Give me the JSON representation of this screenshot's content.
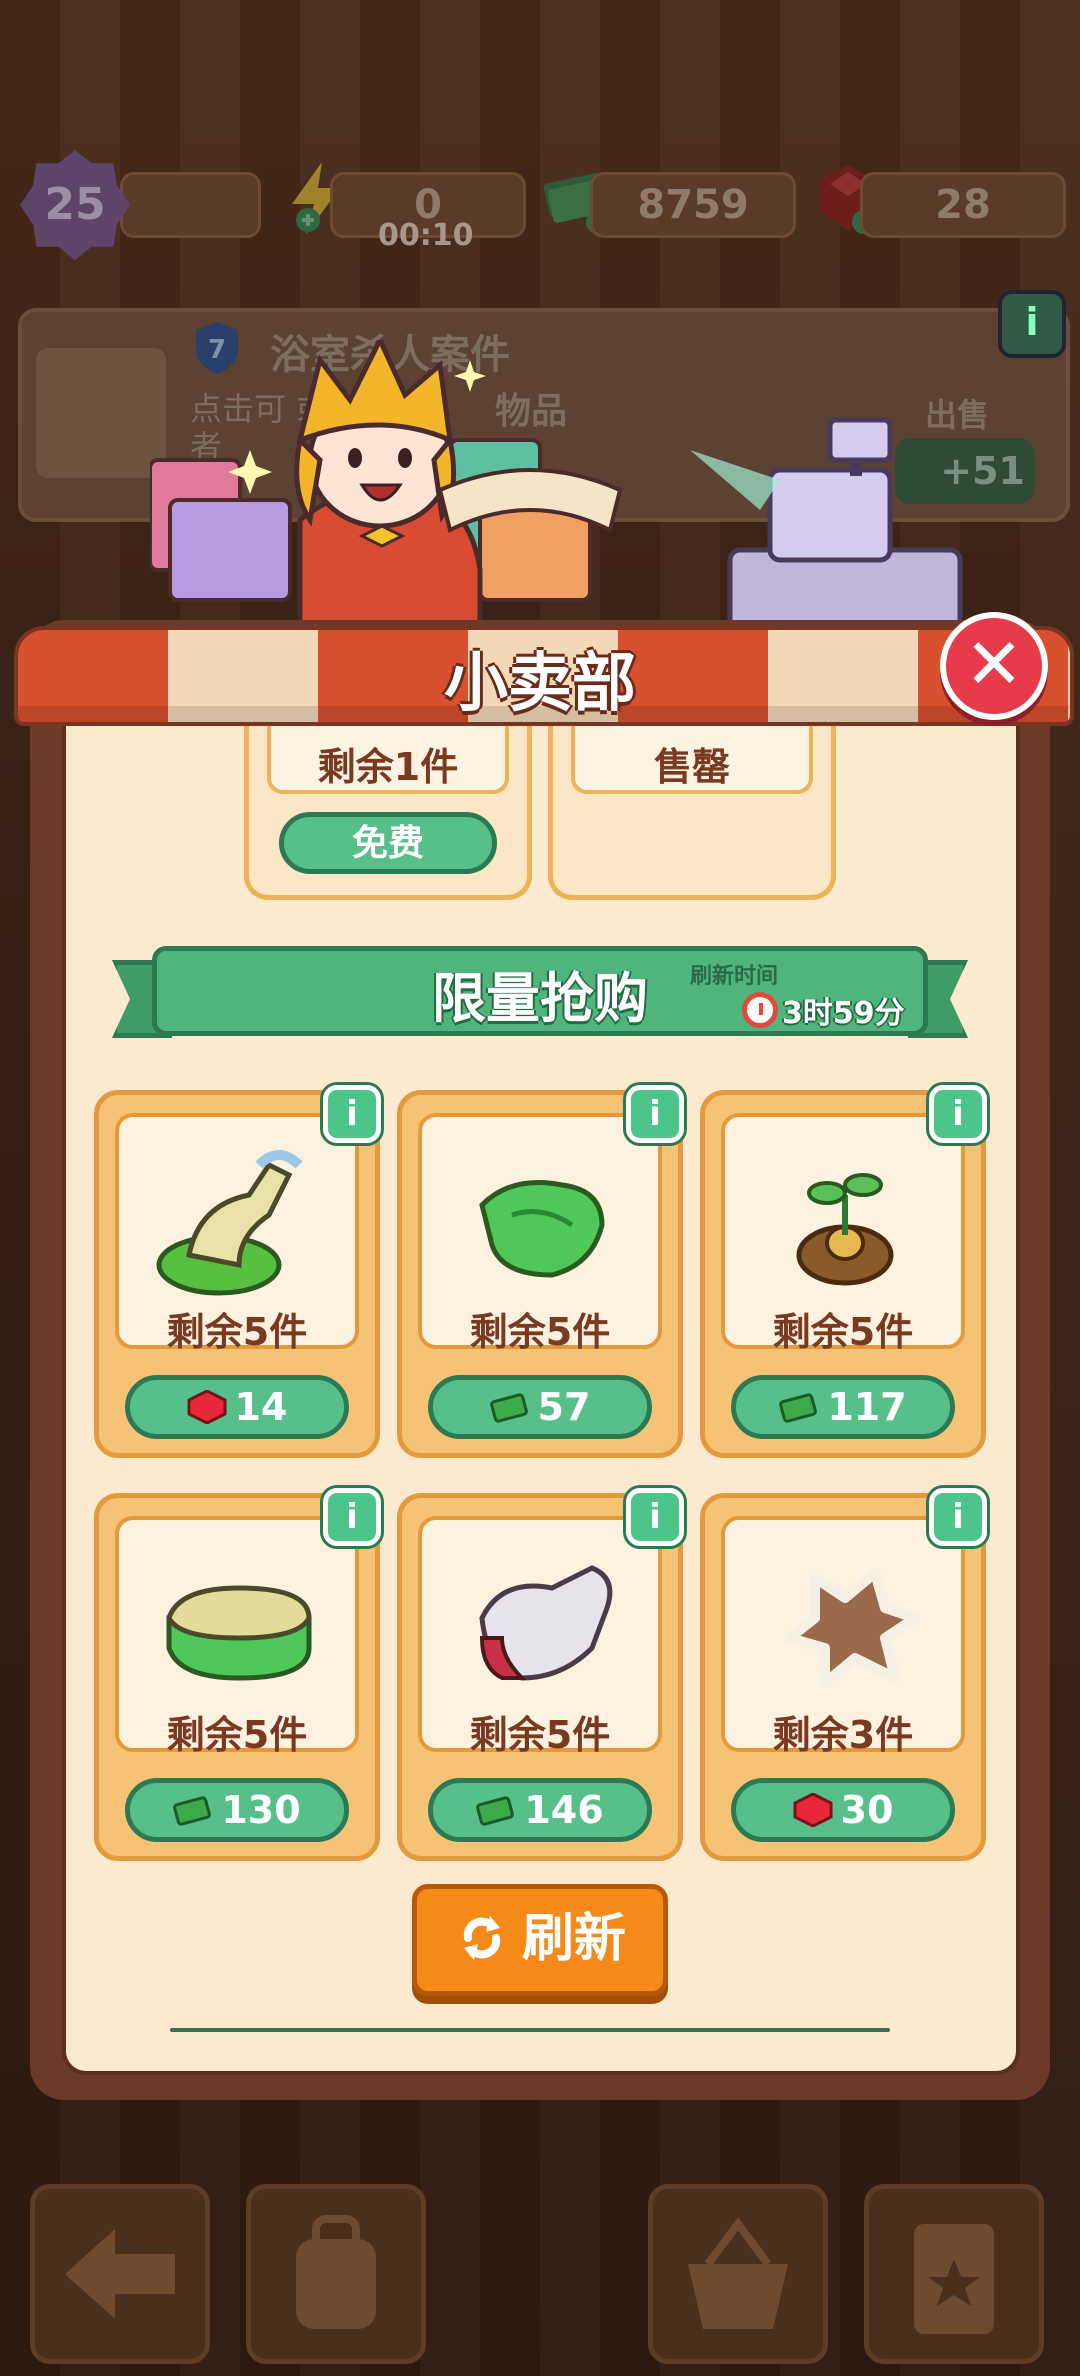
{
  "hud": {
    "level": "25",
    "energy": "0",
    "energy_timer": "00:10",
    "cash": "8759",
    "gems": "28"
  },
  "quest": {
    "badge": "7",
    "title": "浴室杀人案件",
    "subtitle": "点击可 或者",
    "subtitle_tail": "物品",
    "sell_label": "出售",
    "reward": "+51",
    "info": "i"
  },
  "shop": {
    "title": "小卖部",
    "close": "✕",
    "top_cards": [
      {
        "label": "剩余1件",
        "button": "免费"
      },
      {
        "label": "售罄"
      }
    ],
    "section_title": "限量抢购",
    "refresh_label": "刷新时间",
    "refresh_time": "3时59分",
    "items": [
      {
        "remain": "剩余5件",
        "price": "14",
        "currency": "gem",
        "item": "scrub-brush"
      },
      {
        "remain": "剩余5件",
        "price": "57",
        "currency": "cash",
        "item": "green-cloth"
      },
      {
        "remain": "剩余5件",
        "price": "117",
        "currency": "cash",
        "item": "sprout-soil"
      },
      {
        "remain": "剩余5件",
        "price": "130",
        "currency": "cash",
        "item": "sponge"
      },
      {
        "remain": "剩余5件",
        "price": "146",
        "currency": "cash",
        "item": "glove"
      },
      {
        "remain": "剩余3件",
        "price": "30",
        "currency": "gem",
        "item": "stain"
      }
    ],
    "info": "i",
    "refresh_button": "刷新"
  },
  "colors": {
    "green": "#57c08a",
    "orange": "#f58a18",
    "red": "#e73a4a",
    "panel": "#fbead0"
  }
}
